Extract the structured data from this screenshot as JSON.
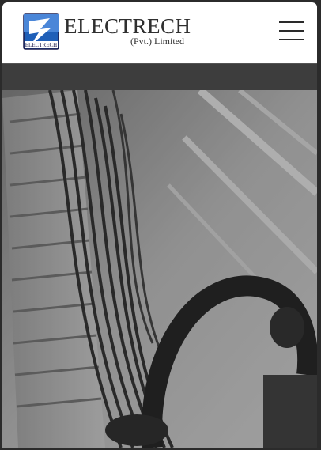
{
  "header": {
    "logo": {
      "wordmark": "ELECTRECH",
      "subtitle": "(Pvt.) Limited",
      "mark_caption": "ELECTRECH"
    },
    "menu_icon": "hamburger-menu-icon"
  },
  "hero": {
    "image": "cable-installation-photo"
  },
  "colors": {
    "header_bg": "#ffffff",
    "page_bg": "#2b2b2b",
    "logo_blue": "#1f5fb8",
    "text_dark": "#2f2f2f"
  }
}
